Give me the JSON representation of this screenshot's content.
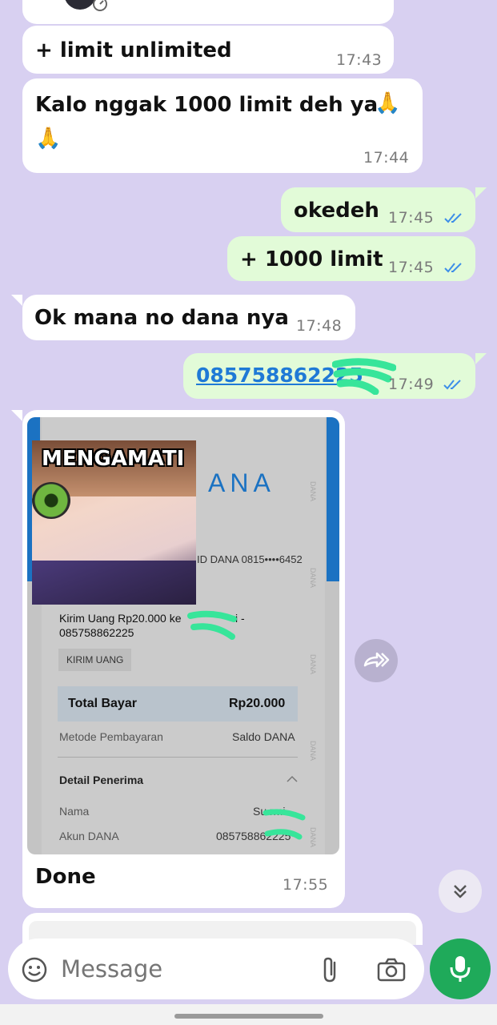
{
  "messages": {
    "m1": {
      "text": "+ limit unlimited",
      "time": "17:43"
    },
    "m2": {
      "line1": "Kalo nggak 1000 limit  deh ya",
      "emoji": "🙏",
      "time": "17:44"
    },
    "m3": {
      "text": "okedeh",
      "time": "17:45"
    },
    "m4": {
      "text": "+ 1000 limit",
      "time": "17:45"
    },
    "m5": {
      "text": "Ok mana no dana nya",
      "time": "17:48"
    },
    "m6": {
      "text": "085758862225",
      "time": "17:49"
    },
    "m7": {
      "caption": "Done",
      "time": "17:55"
    }
  },
  "receipt": {
    "brand": "DANA",
    "brand_visible": "ANA",
    "id_line": "ID DANA 0815••••6452",
    "transfer_line1": "Kirim Uang Rp20.000 ke",
    "transfer_name_tail": "i -",
    "transfer_line2": "085758862225",
    "tag": "KIRIM UANG",
    "total_label": "Total Bayar",
    "total_value": "Rp20.000",
    "method_label": "Metode Pembayaran",
    "method_value": "Saldo DANA",
    "recipient_title": "Detail Penerima",
    "name_label": "Nama",
    "name_value": "Su   rmi",
    "account_label": "Akun DANA",
    "account_value": "085758862225",
    "watermark": "DANA"
  },
  "sticker": {
    "text": "MENGAMATI"
  },
  "composer": {
    "placeholder": "Message"
  },
  "colors": {
    "chat_bg": "#d8d0f1",
    "incoming": "#ffffff",
    "outgoing": "#e2fbd8",
    "tick_blue": "#3d8ee8",
    "link_blue": "#1f7ad6",
    "mic_green": "#1faa5a",
    "dana_blue": "#1b72c2",
    "scribble_green": "#37e59a"
  },
  "icons": {
    "emoji": "emoji-icon",
    "attach": "paperclip-icon",
    "camera": "camera-icon",
    "mic": "mic-icon",
    "forward": "forward-icon",
    "scroll": "double-chevron-down-icon",
    "ticks": "double-check-icon"
  }
}
